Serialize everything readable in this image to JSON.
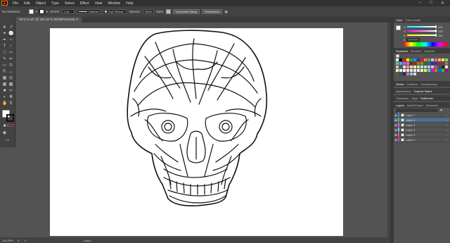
{
  "app": {
    "logo": "Ai"
  },
  "menu": [
    "File",
    "Edit",
    "Object",
    "Type",
    "Select",
    "Effect",
    "View",
    "Window",
    "Help"
  ],
  "control": {
    "selection": "No Selection",
    "stroke_label": "Stroke:",
    "stroke_weight": "1 pt",
    "profile": "Uniform",
    "brush": "5 pt. Round",
    "opacity_label": "Opacity:",
    "opacity_value": "100%",
    "style_label": "Style:",
    "doc_setup": "Document Setup",
    "preferences": "Preferences"
  },
  "document_tab": "SKT.AA.ai* @ 104.16 % (RGB/Preview)",
  "status": {
    "zoom": "104.29%",
    "rotation": "0°",
    "artboard": "1",
    "tool": "Lasso"
  },
  "panels": {
    "color_tabs": [
      "Color",
      "Color Guide"
    ],
    "color_rows": [
      "R",
      "G",
      "B"
    ],
    "color_values": [
      "255",
      "255",
      "255"
    ],
    "hex_label": "#",
    "hex_value": "FFFFFF",
    "swatch_tabs": [
      "Swatches",
      "Brushes",
      "Symbols"
    ],
    "stroke_tabs": [
      "Stroke",
      "Gradient",
      "Transparency"
    ],
    "appearance_tabs": [
      "Appearance",
      "Graphic Styles"
    ],
    "transform_tabs": [
      "Transform",
      "Align",
      "Pathfinder"
    ],
    "layers_tabs": [
      "Layers",
      "Asset Export",
      "Artboards"
    ],
    "layers": [
      {
        "name": "Layer 7",
        "color": "#4f80ff",
        "selected": false
      },
      {
        "name": "Layer 6",
        "color": "#3ac73a",
        "selected": true
      },
      {
        "name": "Layer 4",
        "color": "#ff4ff0",
        "selected": false
      },
      {
        "name": "Layer 3",
        "color": "#4fd7ff",
        "selected": false
      },
      {
        "name": "Layer 2",
        "color": "#ff4f4f",
        "selected": false
      },
      {
        "name": "Layer 1",
        "color": "#a44fff",
        "selected": false
      }
    ]
  },
  "colors": {
    "accent": "#ff9a00",
    "ui_dark": "#323232",
    "ui_mid": "#535353",
    "artboard": "#ffffff"
  }
}
